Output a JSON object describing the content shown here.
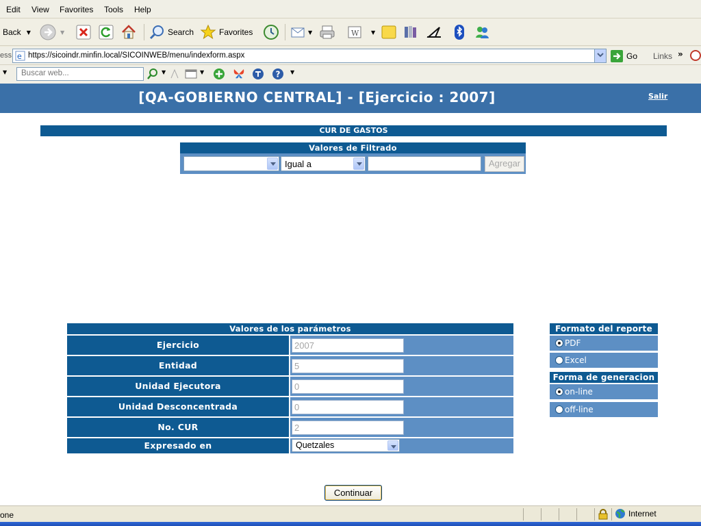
{
  "menu": [
    "Edit",
    "View",
    "Favorites",
    "Tools",
    "Help"
  ],
  "toolbar": {
    "back_label": "Back",
    "search_label": "Search",
    "favorites_label": "Favorites"
  },
  "address": {
    "label": "ess",
    "url": "https://sicoindr.minfin.local/SICOINWEB/menu/indexform.aspx",
    "go_label": "Go",
    "links_label": "Links"
  },
  "searchbar": {
    "placeholder": "Buscar web..."
  },
  "header": {
    "title": "[QA-GOBIERNO CENTRAL] - [Ejercicio : 2007]",
    "logout": "Salir"
  },
  "section_title": "CUR DE GASTOS",
  "filter": {
    "title": "Valores de Filtrado",
    "field_value": "",
    "operator_value": "Igual a",
    "text_value": "",
    "add_button": "Agregar"
  },
  "params": {
    "title": "Valores de los parámetros",
    "rows": [
      {
        "label": "Ejercicio",
        "value": "2007"
      },
      {
        "label": "Entidad",
        "value": "5"
      },
      {
        "label": "Unidad Ejecutora",
        "value": "0"
      },
      {
        "label": "Unidad Desconcentrada",
        "value": "0"
      },
      {
        "label": "No. CUR",
        "value": "2"
      }
    ],
    "currency_label": "Expresado en",
    "currency_value": "Quetzales"
  },
  "report_format": {
    "title": "Formato del reporte",
    "options": [
      "PDF",
      "Excel"
    ],
    "selected": "PDF"
  },
  "generation": {
    "title": "Forma de generacion",
    "options": [
      "on-line",
      "off-line"
    ],
    "selected": "on-line"
  },
  "continue_button": "Continuar",
  "status": {
    "text": "one",
    "zone": "Internet"
  }
}
